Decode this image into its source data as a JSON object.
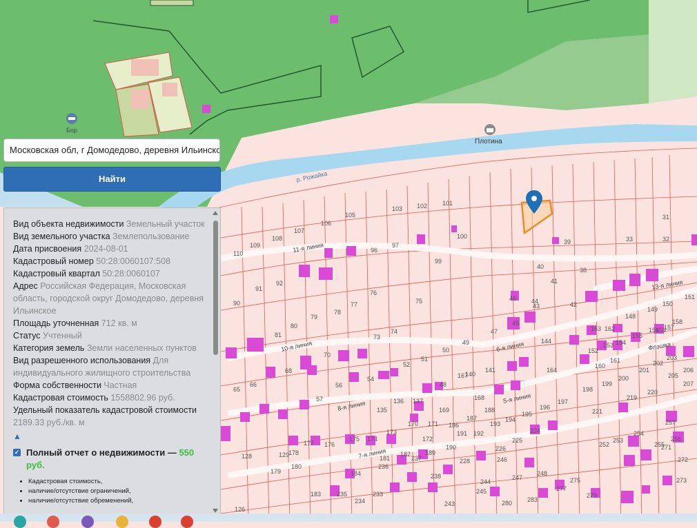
{
  "search": {
    "value": "Московская обл, г Домодедово, деревня Ильинско",
    "button_label": "Найти"
  },
  "map_labels": {
    "bor": "Бор",
    "plotina": "Плотина",
    "river": "р. Рожайка",
    "streets": [
      "11-я линия",
      "10-я линия",
      "8-я линия",
      "7-я линия",
      "6-я линия",
      "5-я линия",
      "13-я линия",
      "Флэшка"
    ]
  },
  "parcel_numbers": [
    "101",
    "102",
    "103",
    "105",
    "106",
    "107",
    "108",
    "109",
    "110",
    "99",
    "100",
    "97",
    "96",
    "91",
    "92",
    "90",
    "77",
    "76",
    "78",
    "79",
    "80",
    "81",
    "73",
    "74",
    "75",
    "47",
    "49",
    "50",
    "51",
    "52",
    "48",
    "46",
    "45",
    "44",
    "43",
    "42",
    "41",
    "40",
    "38",
    "39",
    "33",
    "32",
    "31",
    "70",
    "68",
    "66",
    "65",
    "57",
    "56",
    "54",
    "135",
    "136",
    "137",
    "170",
    "168",
    "167",
    "140",
    "141",
    "144",
    "164",
    "195",
    "196",
    "197",
    "198",
    "199",
    "200",
    "201",
    "202",
    "203",
    "206",
    "205",
    "207",
    "219",
    "220",
    "221",
    "224",
    "225",
    "226",
    "228",
    "233",
    "234",
    "235",
    "236",
    "237",
    "238",
    "243",
    "244",
    "245",
    "246",
    "247",
    "248",
    "252",
    "253",
    "254",
    "255",
    "256",
    "257",
    "271",
    "272",
    "273",
    "275",
    "277",
    "279",
    "280",
    "283",
    "128",
    "129",
    "126",
    "179",
    "183",
    "184",
    "148",
    "149",
    "150",
    "151",
    "152",
    "153",
    "154",
    "155",
    "156",
    "157",
    "158",
    "159",
    "160",
    "161",
    "162",
    "163",
    "169",
    "171",
    "172",
    "173",
    "174",
    "175",
    "176",
    "177",
    "178",
    "180",
    "181",
    "182",
    "189",
    "190",
    "191",
    "192",
    "193",
    "194",
    "186",
    "187",
    "188"
  ],
  "info": [
    {
      "key": "Вид объекта недвижимости",
      "value": "Земельный участок"
    },
    {
      "key": "Вид земельного участка",
      "value": "Землепользование"
    },
    {
      "key": "Дата присвоения",
      "value": "2024-08-01"
    },
    {
      "key": "Кадастровый номер",
      "value": "50:28:0060107:508"
    },
    {
      "key": "Кадастровый квартал",
      "value": "50:28:0060107"
    },
    {
      "key": "Адрес",
      "value": "Российская Федерация, Московская область, городской округ Домодедово, деревня Ильинское"
    },
    {
      "key": "Площадь уточненная",
      "value": "712 кв. м"
    },
    {
      "key": "Статус",
      "value": "Учтенный"
    },
    {
      "key": "Категория земель",
      "value": "Земли населенных пунктов"
    },
    {
      "key": "Вид разрешенного использования",
      "value": "Для индивидуального жилищного строительства"
    },
    {
      "key": "Форма собственности",
      "value": "Частная"
    },
    {
      "key": "Кадастровая стоимость",
      "value": "1558802.96 руб."
    },
    {
      "key": "Удельный показатель кадастровой стоимости",
      "value": "2189.33 руб./кв. м"
    }
  ],
  "collapse_glyph": "▲",
  "report": {
    "title": "Полный отчет о недвижимости — ",
    "price": "550 руб.",
    "items": [
      "Кадастровая стоимость,",
      "наличие/отсутствие ограничений,",
      "наличие/отсутствие обременений,"
    ]
  },
  "colors": {
    "forest": "#6dbd6e",
    "meadow": "#a9d49b",
    "river": "#a8d8f0",
    "parcel_fill": "#fbe3df",
    "parcel_line": "#e05a4e",
    "building": "#d94bd6",
    "selected": "#f08a24",
    "accent": "#2f6db5"
  }
}
